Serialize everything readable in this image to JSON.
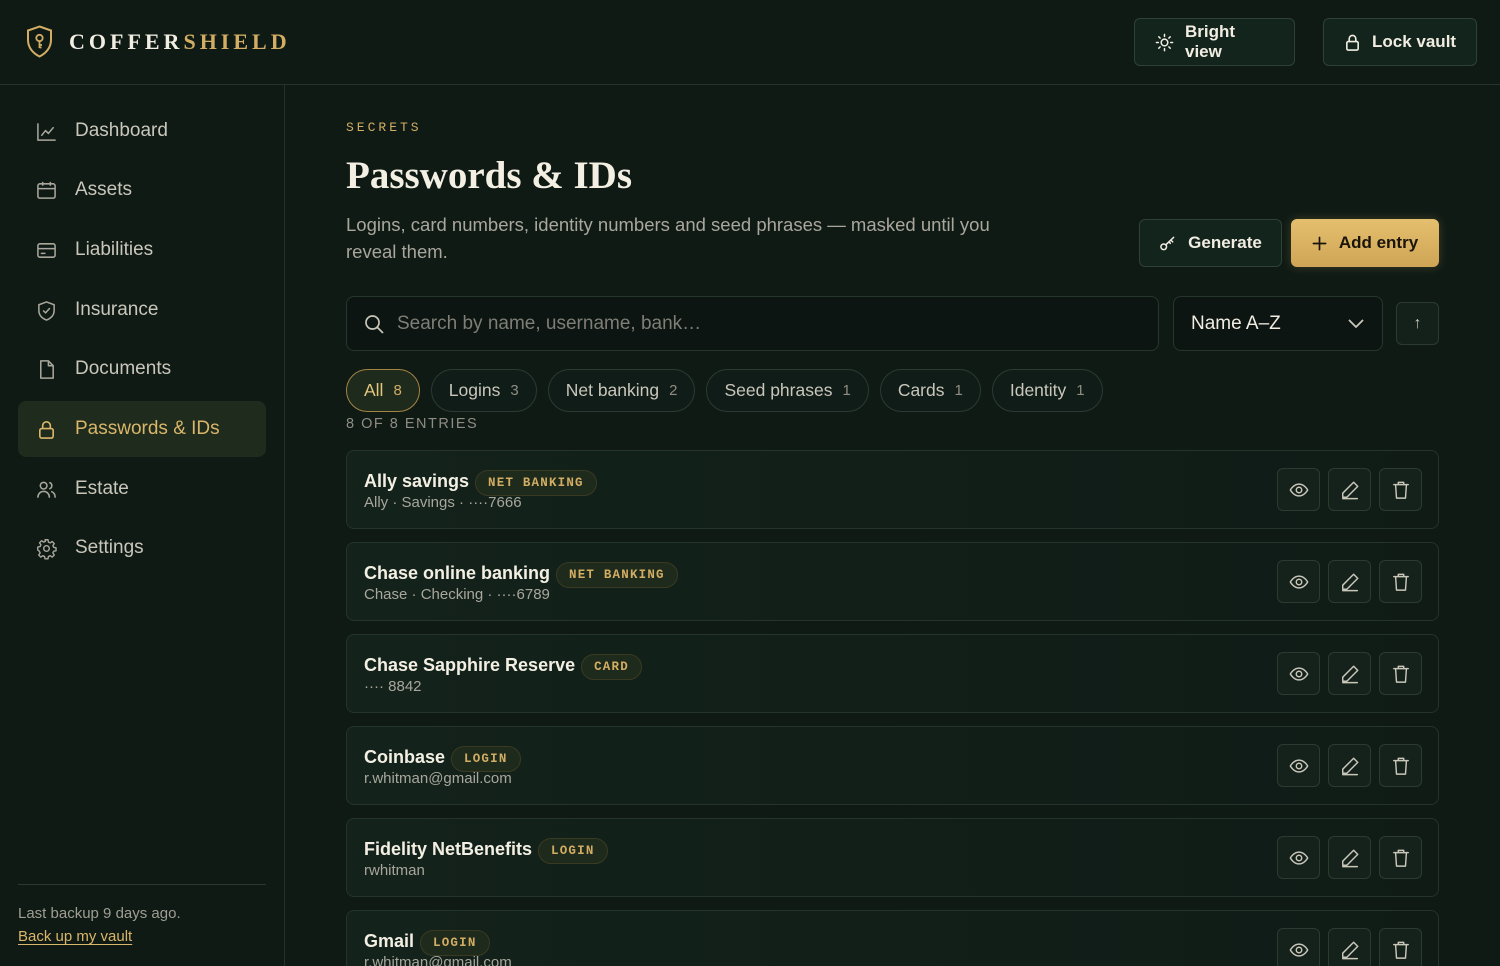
{
  "brand": {
    "name_part1": "COFFER",
    "name_part2": "SHIELD"
  },
  "header": {
    "bright_view": "Bright view",
    "lock_vault": "Lock vault"
  },
  "sidebar": {
    "items": [
      {
        "label": "Dashboard",
        "icon": "chart-icon"
      },
      {
        "label": "Assets",
        "icon": "calendar-icon"
      },
      {
        "label": "Liabilities",
        "icon": "credit-card-icon"
      },
      {
        "label": "Insurance",
        "icon": "shield-check-icon"
      },
      {
        "label": "Documents",
        "icon": "document-icon"
      },
      {
        "label": "Passwords & IDs",
        "icon": "lock-icon",
        "active": true
      },
      {
        "label": "Estate",
        "icon": "users-icon"
      },
      {
        "label": "Settings",
        "icon": "gear-icon"
      }
    ],
    "backup_text": "Last backup 9 days ago.",
    "backup_link": "Back up my vault"
  },
  "main": {
    "eyebrow": "SECRETS",
    "title": "Passwords & IDs",
    "description": "Logins, card numbers, identity numbers and seed phrases — masked until you reveal them.",
    "generate": "Generate",
    "add_entry": "Add entry",
    "search_placeholder": "Search by name, username, bank…",
    "sort": "Name A–Z",
    "sort_direction": "↑",
    "filters": [
      {
        "label": "All",
        "count": "8",
        "active": true
      },
      {
        "label": "Logins",
        "count": "3"
      },
      {
        "label": "Net banking",
        "count": "2"
      },
      {
        "label": "Seed phrases",
        "count": "1"
      },
      {
        "label": "Cards",
        "count": "1"
      },
      {
        "label": "Identity",
        "count": "1"
      }
    ],
    "entries_count": "8 OF 8 ENTRIES",
    "entries": [
      {
        "name": "Ally savings",
        "badge": "NET BANKING",
        "sub": "Ally · Savings · ····7666"
      },
      {
        "name": "Chase online banking",
        "badge": "NET BANKING",
        "sub": "Chase · Checking · ····6789"
      },
      {
        "name": "Chase Sapphire Reserve",
        "badge": "CARD",
        "sub": "···· 8842"
      },
      {
        "name": "Coinbase",
        "badge": "LOGIN",
        "sub": "r.whitman@gmail.com"
      },
      {
        "name": "Fidelity NetBenefits",
        "badge": "LOGIN",
        "sub": "rwhitman"
      },
      {
        "name": "Gmail",
        "badge": "LOGIN",
        "sub": "r.whitman@gmail.com"
      }
    ]
  },
  "colors": {
    "accent": "#d2ad63",
    "background": "#0f1a15",
    "text": "#f1ede2"
  }
}
